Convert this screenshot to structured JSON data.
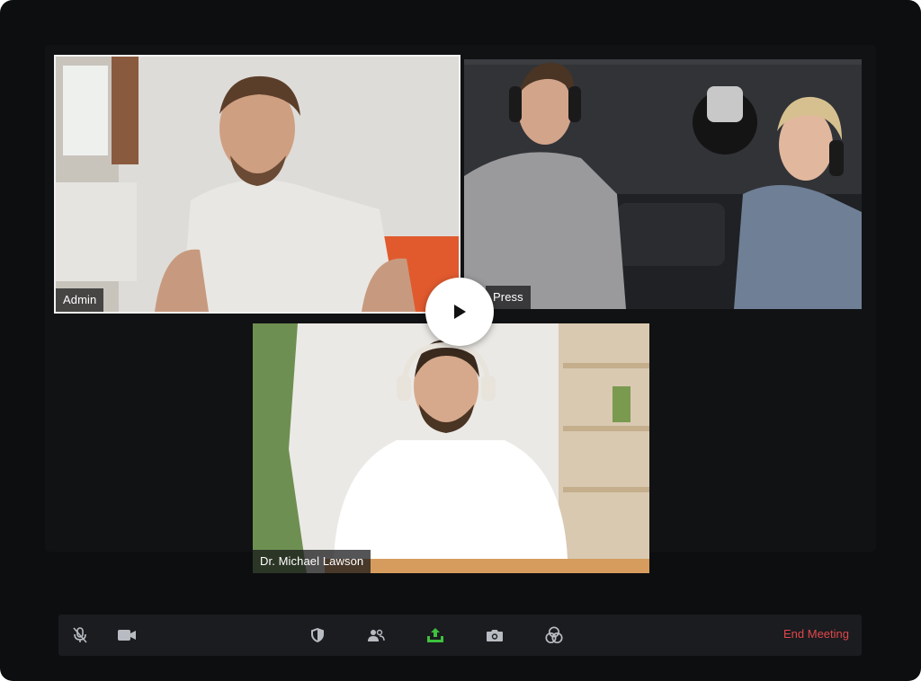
{
  "participants": [
    {
      "name": "Admin"
    },
    {
      "name": "Press"
    },
    {
      "name": "Dr. Michael Lawson"
    }
  ],
  "toolbar": {
    "icons": [
      "mic-off-icon",
      "video-camera-icon",
      "shield-icon",
      "participants-icon",
      "share-screen-icon",
      "snapshot-icon",
      "effects-icon"
    ],
    "end_meeting_label": "End Meeting",
    "share_color": "#3ec13e",
    "end_color": "#e0474c"
  }
}
